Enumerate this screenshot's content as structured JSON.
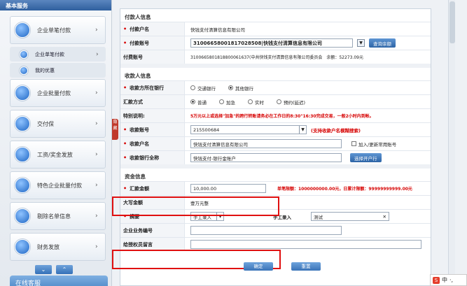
{
  "sidebar": {
    "header": "基本服务",
    "items": [
      {
        "label": "企业单笔付款",
        "arrow": "›"
      },
      {
        "label": "企业单笔付款",
        "arrow": "›",
        "sub": true
      },
      {
        "label": "我的优惠",
        "sub": true
      },
      {
        "label": "企业批量付款",
        "arrow": "›"
      },
      {
        "label": "交付保",
        "arrow": "›"
      },
      {
        "label": "工资/奖金发放",
        "arrow": "›"
      },
      {
        "label": "特色企业批量付款",
        "arrow": "›"
      },
      {
        "label": "剔除名单信息",
        "arrow": "›"
      },
      {
        "label": "财务发放",
        "arrow": "›"
      }
    ],
    "more_down": "⌄",
    "more_up": "⌃",
    "online_label": "在线客服",
    "collapse_label": "隐藏"
  },
  "payer": {
    "title": "付款人信息",
    "name_label": "付款户名",
    "name_value": "快钱支付清算信息有限公司",
    "account_label": "付款账号",
    "account_value": "31006658001817028508|快钱支付清算信息有限公司",
    "query_btn": "查询余额",
    "voucher_label": "付费账号",
    "voucher_value": "3100665801818800061637(中共快钱支付清算信息有限公司委员会",
    "balance": "余额：52273.09元"
  },
  "payee": {
    "title": "收款人信息",
    "bank_type_label": "收款方所在银行",
    "bank_opt1": "交通银行",
    "bank_opt2": "其他银行",
    "method_label": "汇款方式",
    "method_opts": [
      "普通",
      "加急",
      "实时",
      "预约(延迟)"
    ],
    "notice_label": "特别说明:",
    "notice_text": "5万元以上或选择\"加急\"的跨行转账请务必在工作日的8:30\"16:30完成交易，一般2小时内到帐。",
    "account_label": "收款账号",
    "account_value": "215500684",
    "account_hint": "(支持收款户名模糊搜索)",
    "name_label": "收款户名",
    "name_value": "快钱支付清算信息有限公司",
    "add_label": "加入/更新常用账号",
    "bank_label": "收款银行全称",
    "bank_value": "快钱支付-银行金账户",
    "bank_btn": "选择开户行"
  },
  "amount": {
    "title": "资金信息",
    "amount_label": "汇款金额",
    "amount_value": "10,000.00",
    "limit_text": "单笔限额：1000000000.00元，日累计限额：99999999999.00元",
    "upper_label": "大写金额",
    "upper_value": "壹万元整",
    "memo_label": "摘要",
    "memo_select": "手工录入",
    "memo_manual_label": "手工录入",
    "memo_input": "测试",
    "memo_clear": "✕",
    "biz_no_label": "企业业务编号",
    "check_label": "给授权员留言"
  },
  "footer": {
    "confirm": "确定",
    "reset": "重置"
  },
  "tray": {
    "text": "中",
    "extra": "·,"
  }
}
